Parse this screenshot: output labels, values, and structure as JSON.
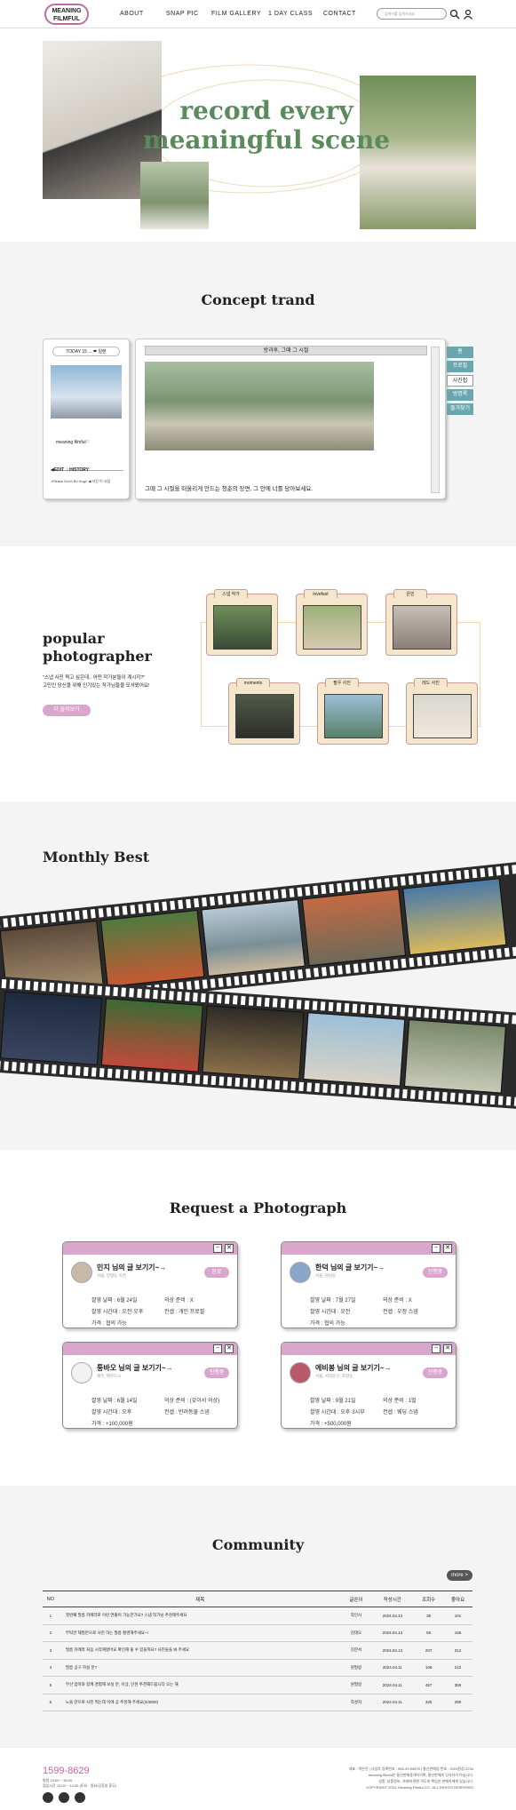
{
  "brand": {
    "logo_line1": "MEANING",
    "logo_line2": "FILMFUL"
  },
  "nav": {
    "items": [
      "ABOUT",
      "SNAP PIC",
      "FILM GALLERY",
      "1 DAY CLASS",
      "CONTACT"
    ]
  },
  "search": {
    "placeholder": "검색어를 입력하세요"
  },
  "hero": {
    "title_line1": "record every",
    "title_line2": "meaningful scene"
  },
  "concept": {
    "title": "Concept trand",
    "today_label": "TODAY 15 ... ❤ 일렌",
    "profile_caption": "meaning filmful♡",
    "history_label": "◀EDIT ☆HISTORY",
    "player_text": "♪Please Don't Be Hug!! ◀ 사진 이 사람",
    "window_title": "방과후, 그때 그 시절",
    "caption": "그때 그 시절을 떠올리게 만드는 청춘의 장면, 그 안에 너를 담아보세요.",
    "tabs": [
      "홈",
      "프로필",
      "사진첩",
      "방명록",
      "즐겨찾기"
    ]
  },
  "photographer": {
    "title_line1": "popular",
    "title_line2": "photographer",
    "desc_line1": "\"스냅 사진 찍고 싶은데.. 어떤 작가분들이 계시지?\"",
    "desc_line2": "고민인 당신을 위해 인기있는 작가님들을 모셔왔어요!",
    "button": "더 둘러보기",
    "folders": [
      "스냅 작가",
      "lovefast",
      "은빈",
      "moments",
      "필우 사진",
      "레드 사진"
    ]
  },
  "monthly": {
    "title": "Monthly Best"
  },
  "request": {
    "title": "Request a Photograph",
    "cards": [
      {
        "name": "민지 님의 글 보기기~→",
        "sub": "서울, 양평동 이천",
        "badge": "완료",
        "date": "촬영 날짜 : 6월 24일",
        "time": "촬영 시간대 : 오전·오후",
        "price": "가격 : 협의 가능",
        "outfit": "의상 준비 : X",
        "concept": "컨셉 : 개인 프로필"
      },
      {
        "name": "한덕 님의 글 보기기~→",
        "sub": "서울, 관남동",
        "badge": "진행중",
        "date": "촬영 날짜 : 7월 27일",
        "time": "촬영 시간대 : 오전",
        "price": "가격 : 협의 가능",
        "outfit": "의상 준비 : X",
        "concept": "컨셉 : 우정 스냅"
      },
      {
        "name": "퉁바오 님의 글 보기기~→",
        "sub": "제주, 제주도시",
        "badge": "진행중",
        "date": "촬영 날짜 : 6월 14일",
        "time": "촬영 시간대 : 오후",
        "price": "가격 : +100,000원",
        "outfit": "의상 준비 : (갖이서 의상)",
        "concept": "컨셉 : 반려동물 스냅"
      },
      {
        "name": "에비봉 님의 글 보기기~→",
        "sub": "서울, 서대문구, 포항동",
        "badge": "진행중",
        "date": "촬영 날짜 : 9월 21일",
        "time": "촬영 시간대 : 오후·3시부",
        "price": "가격 : +500,000원",
        "outfit": "의상 준비 : 1벌",
        "concept": "컨셉 : 웨딩 스냅"
      }
    ]
  },
  "community": {
    "title": "Community",
    "more": "more >",
    "headers": [
      "NO",
      "제목",
      "글쓴이",
      "작성시간",
      "조회수",
      "좋아요"
    ],
    "rows": [
      [
        "1",
        "첫번째 필름 카메라로 이런 연출이 가능한가요? 스냅 작가님 추천해주세요",
        "작인사",
        "2024.04.13",
        "35",
        "101"
      ],
      [
        "2",
        "부탁한 재질만으로 사진 하는 필름 촬영해주세요~!",
        "김테오",
        "2024.04.13",
        "56",
        "155"
      ],
      [
        "3",
        "필름 카메라 처음 시작해봤어요 확인해 줄 수 있을까요? 사진들을 봐 주세요",
        "김한서",
        "2024.04.13",
        "207",
        "312"
      ],
      [
        "4",
        "필름 공구 하실 분?",
        "원필랑",
        "2024.04.11",
        "108",
        "212"
      ],
      [
        "5",
        "부산 엄마와 함께 경험해 보실 분, 이상, 인천 추천해드립니다 오는 해",
        "원필랑",
        "2024.04.11",
        "457",
        "355"
      ],
      [
        "6",
        "노을 만으로 사진 찍는데 이에 공 추천해 주세요(2/3000)",
        "작성자",
        "2024.04.11",
        "325",
        "280"
      ]
    ]
  },
  "footer": {
    "phone": "1599-8629",
    "hours_line1": "평일 10:00 ~ 18:00",
    "hours_line2": "점심시간 13:00 ~ 14:00 (토요 · 일요/공휴일 휴무)",
    "info_line1": "대표 : 박은진  |  사업자 등록번호 : 985-29-99875  |  통신판매업 번호 : 2024원강나234",
    "info_line2": "meaning filmful은 통신판매중개자이며, 통신판매의 당사자가 아닙니다.",
    "info_line3": "상품, 상품정보, 거래에 관한 의무와 책임은 판매자에게 있습니다.",
    "copyright": "COPYRIGHT 2024. Meaning Filmful CO., ALL RIGHTS RESERVED"
  },
  "colors": {
    "accent_pink": "#d9a6cd",
    "hero_green": "#5b8a5c",
    "teal_tab": "#6aa6ad"
  }
}
